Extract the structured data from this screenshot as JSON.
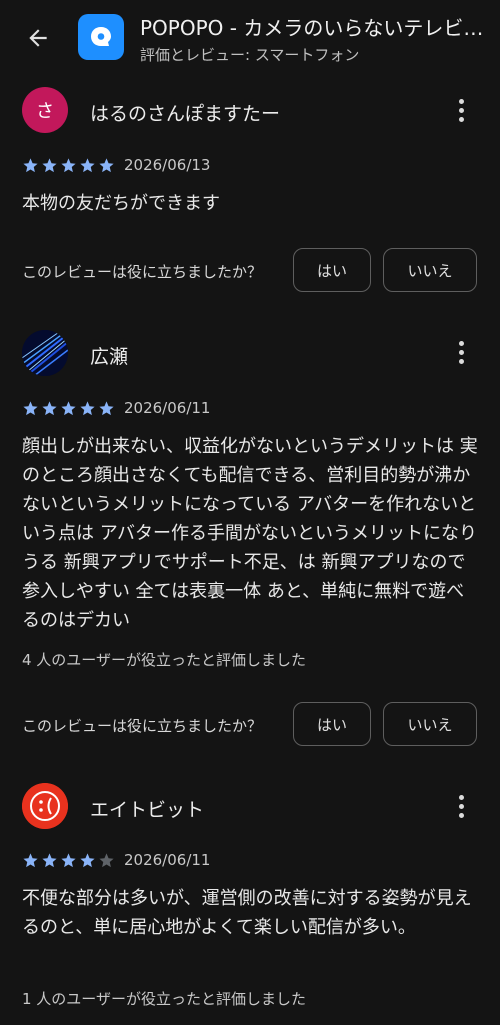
{
  "header": {
    "back_icon": "arrow-left-icon",
    "app_title": "POPOPO - カメラのいらないテレビ電…",
    "subtitle": "評価とレビュー: スマートフォン",
    "app_icon": "speech-bubble-icon",
    "app_icon_color": "#1e8fff"
  },
  "reviews": [
    {
      "author": "はるのさんぽますたー",
      "avatar_letter": "さ",
      "avatar_color": "#c2185b",
      "rating": 5,
      "date": "2026/06/13",
      "text": "本物の友だちができます",
      "question": "このレビューは役に立ちましたか？",
      "yes": "はい",
      "no": "いいえ"
    },
    {
      "author": "広瀬",
      "avatar_icon": "blue-light-streaks-avatar",
      "rating": 5,
      "date": "2026/06/11",
      "text": "顔出しが出来ない、収益化がないというデメリットは 実のところ顔出さなくても配信できる、営利目的勢が沸かないというメリットになっている アバターを作れないという点は アバター作る手間がないというメリットになりうる 新興アプリでサポート不足、は 新興アプリなので参入しやすい 全ては表裏一体 あと、単純に無料で遊べるのはデカい",
      "helpful": "4 人のユーザーが役立ったと評価しました",
      "question": "このレビューは役に立ちましたか？",
      "yes": "はい",
      "no": "いいえ"
    },
    {
      "author": "エイトビット",
      "avatar_icon": "sad-face-avatar",
      "avatar_color": "#e8321e",
      "rating": 4,
      "date": "2026/06/11",
      "text": "不便な部分は多いが、運営側の改善に対する姿勢が見えるのと、単に居心地がよくて楽しい配信が多い。",
      "helpful": "1 人のユーザーが役立ったと評価しました"
    }
  ],
  "colors": {
    "star_filled": "#8ab4f8",
    "star_empty": "#5f6368",
    "background": "#141414"
  }
}
